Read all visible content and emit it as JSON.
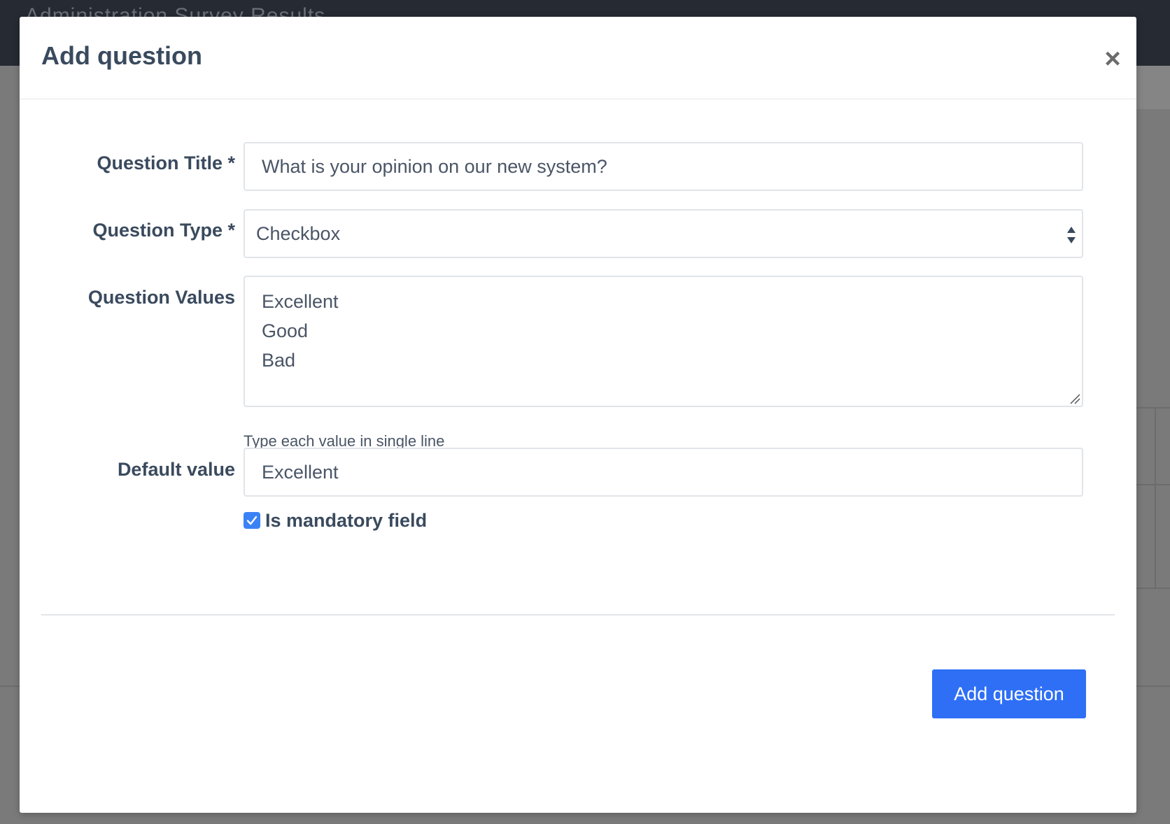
{
  "background": {
    "app_title": "Administration    Survey Results"
  },
  "modal": {
    "title": "Add question",
    "close_label": "×",
    "fields": {
      "question_title": {
        "label": "Question Title *",
        "value": "What is your opinion on our new system?"
      },
      "question_type": {
        "label": "Question Type *",
        "selected": "Checkbox"
      },
      "question_values": {
        "label": "Question Values",
        "lines": [
          "Excellent",
          "Good",
          "Bad"
        ],
        "help_text": "Type each value in single line"
      },
      "default_value": {
        "label": "Default value",
        "value": "Excellent"
      },
      "is_mandatory": {
        "label": "Is mandatory field",
        "checked": true
      }
    },
    "submit_label": "Add question"
  },
  "colors": {
    "primary": "#2e6ff6",
    "checkbox": "#3b82f6",
    "heading_text": "#3a4a5e",
    "backdrop": "#7a7a7a",
    "topbar": "#262a33"
  },
  "icons": {
    "close": "close-icon",
    "select": "sort-arrows-icon",
    "check": "check-icon",
    "resize": "resize-grip-icon"
  }
}
